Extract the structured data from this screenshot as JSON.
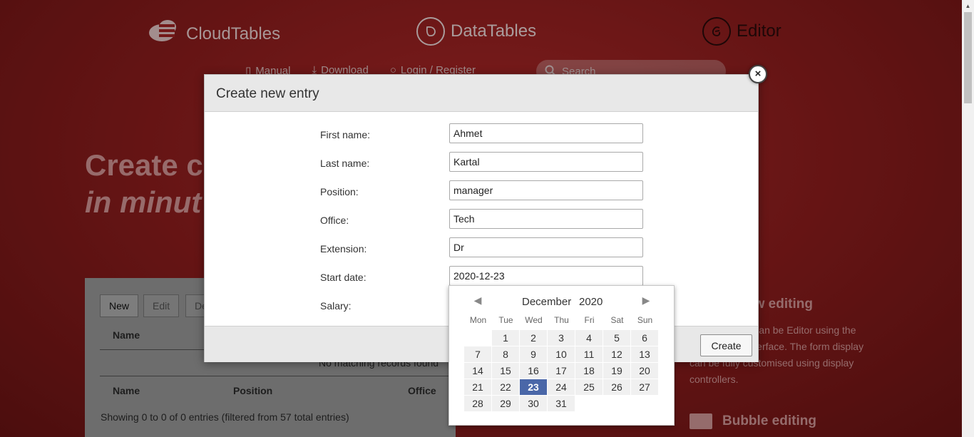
{
  "header": {
    "brands": [
      {
        "name": "CloudTables",
        "icon": "cloud-icon"
      },
      {
        "name": "DataTables",
        "icon": "datatables-logo-icon"
      },
      {
        "name": "Editor",
        "icon": "editor-logo-icon"
      }
    ],
    "nav": [
      {
        "label": "Manual",
        "icon": "document-icon"
      },
      {
        "label": "Download",
        "icon": "download-icon"
      },
      {
        "label": "Login / Register",
        "icon": "user-icon"
      }
    ],
    "search_placeholder": "Search"
  },
  "hero": {
    "line1": "Create c",
    "line2": "in minut"
  },
  "background_table": {
    "buttons": [
      "New",
      "Edit",
      "De"
    ],
    "header_name": "Name",
    "empty_text": "No matching records found",
    "footer_headers": [
      "Name",
      "Position",
      "Office"
    ],
    "info": "Showing 0 to 0 of 0 entries (filtered from 57 total entries)"
  },
  "side": {
    "title1": "ow editing",
    "para": "n a DataTable can be Editor using the main editing interface. The form display can be fully customised using display controllers.",
    "title2": "Bubble editing"
  },
  "modal": {
    "title": "Create new entry",
    "close_label": "×",
    "fields": [
      {
        "label": "First name:",
        "value": "Ahmet"
      },
      {
        "label": "Last name:",
        "value": "Kartal"
      },
      {
        "label": "Position:",
        "value": "manager"
      },
      {
        "label": "Office:",
        "value": "Tech"
      },
      {
        "label": "Extension:",
        "value": "Dr"
      },
      {
        "label": "Start date:",
        "value": "2020-12-23"
      },
      {
        "label": "Salary:",
        "value": ""
      }
    ],
    "create_label": "Create"
  },
  "datepicker": {
    "month": "December",
    "year": "2020",
    "prev_glyph": "◀",
    "next_glyph": "▶",
    "weekdays": [
      "Mon",
      "Tue",
      "Wed",
      "Thu",
      "Fri",
      "Sat",
      "Sun"
    ],
    "leading_blank_days": 1,
    "days_in_month": 31,
    "selected_day": 23
  },
  "scrollbar": {
    "up_glyph": "▲"
  }
}
